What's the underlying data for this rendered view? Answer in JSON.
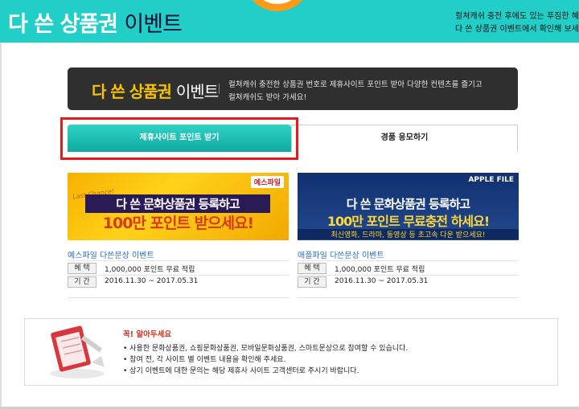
{
  "header": {
    "title_strong": "다 쓴 상품권",
    "title_light": "이벤트",
    "notice_lines": [
      "컬쳐캐쉬 충전 후에도 있는 푸짐한 혜택",
      "다 쓴 상품권 이벤트에서 확인해 보세요"
    ]
  },
  "banner": {
    "title_strong": "다 쓴 상품권",
    "title_light": "이벤트",
    "desc_line1": "컬쳐캐쉬 충전한 상품권 번호로 제휴사이트 포인트 받아 다양한 컨텐츠를 즐기고",
    "desc_line2": "컬쳐캐쉬도 받아 가세요!"
  },
  "tabs": [
    {
      "label": "제휴사이트 포인트 받기",
      "active": true
    },
    {
      "label": "경품 응모하기",
      "active": false
    }
  ],
  "events": [
    {
      "brand": "예스파일",
      "banner_small": "Last Chance!",
      "banner_line1": "다 쓴 문화상품권 등록하고",
      "banner_line2": "100만 포인트 받으세요!",
      "title": "예스파일 다쓴문상 이벤트",
      "benefit_label": "혜 택",
      "benefit": "1,000,000 포인트 무료 적립",
      "period_label": "기 간",
      "period": "2016.11.30 ~ 2017.05.31"
    },
    {
      "brand": "APPLE FILE",
      "banner_line1": "다 쓴 문화상품권 등록하고",
      "banner_line2": "100만 포인트 무료충전 하세요!",
      "banner_line3": "최신영화, 드라마, 동영상 등 초고속 다운 받으세요!",
      "title": "애플파일 다쓴문상 이벤트",
      "benefit_label": "혜 택",
      "benefit": "1,000,000 포인트 무료 적립",
      "period_label": "기 간",
      "period": "2016.11.30 ~ 2017.05.31"
    }
  ],
  "notes": {
    "title": "꼭! 알아두세요",
    "items": [
      "• 사용한 문화상품권, 쇼핑문화상품권, 모바일문화상품권, 스마트문상으로 참여할 수 있습니다.",
      "• 참여 전, 각 사이트 별 이벤트 내용을 확인해 주세요.",
      "• 상기 이벤트에 대한 문의는 해당 제휴사 사이트 고객센터로 주시기 바랍니다."
    ]
  },
  "colors": {
    "header_bg": "#22cfc8",
    "tab_active": "#13b1a8",
    "highlight": "#e51b1b",
    "note_title": "#d2301f"
  }
}
